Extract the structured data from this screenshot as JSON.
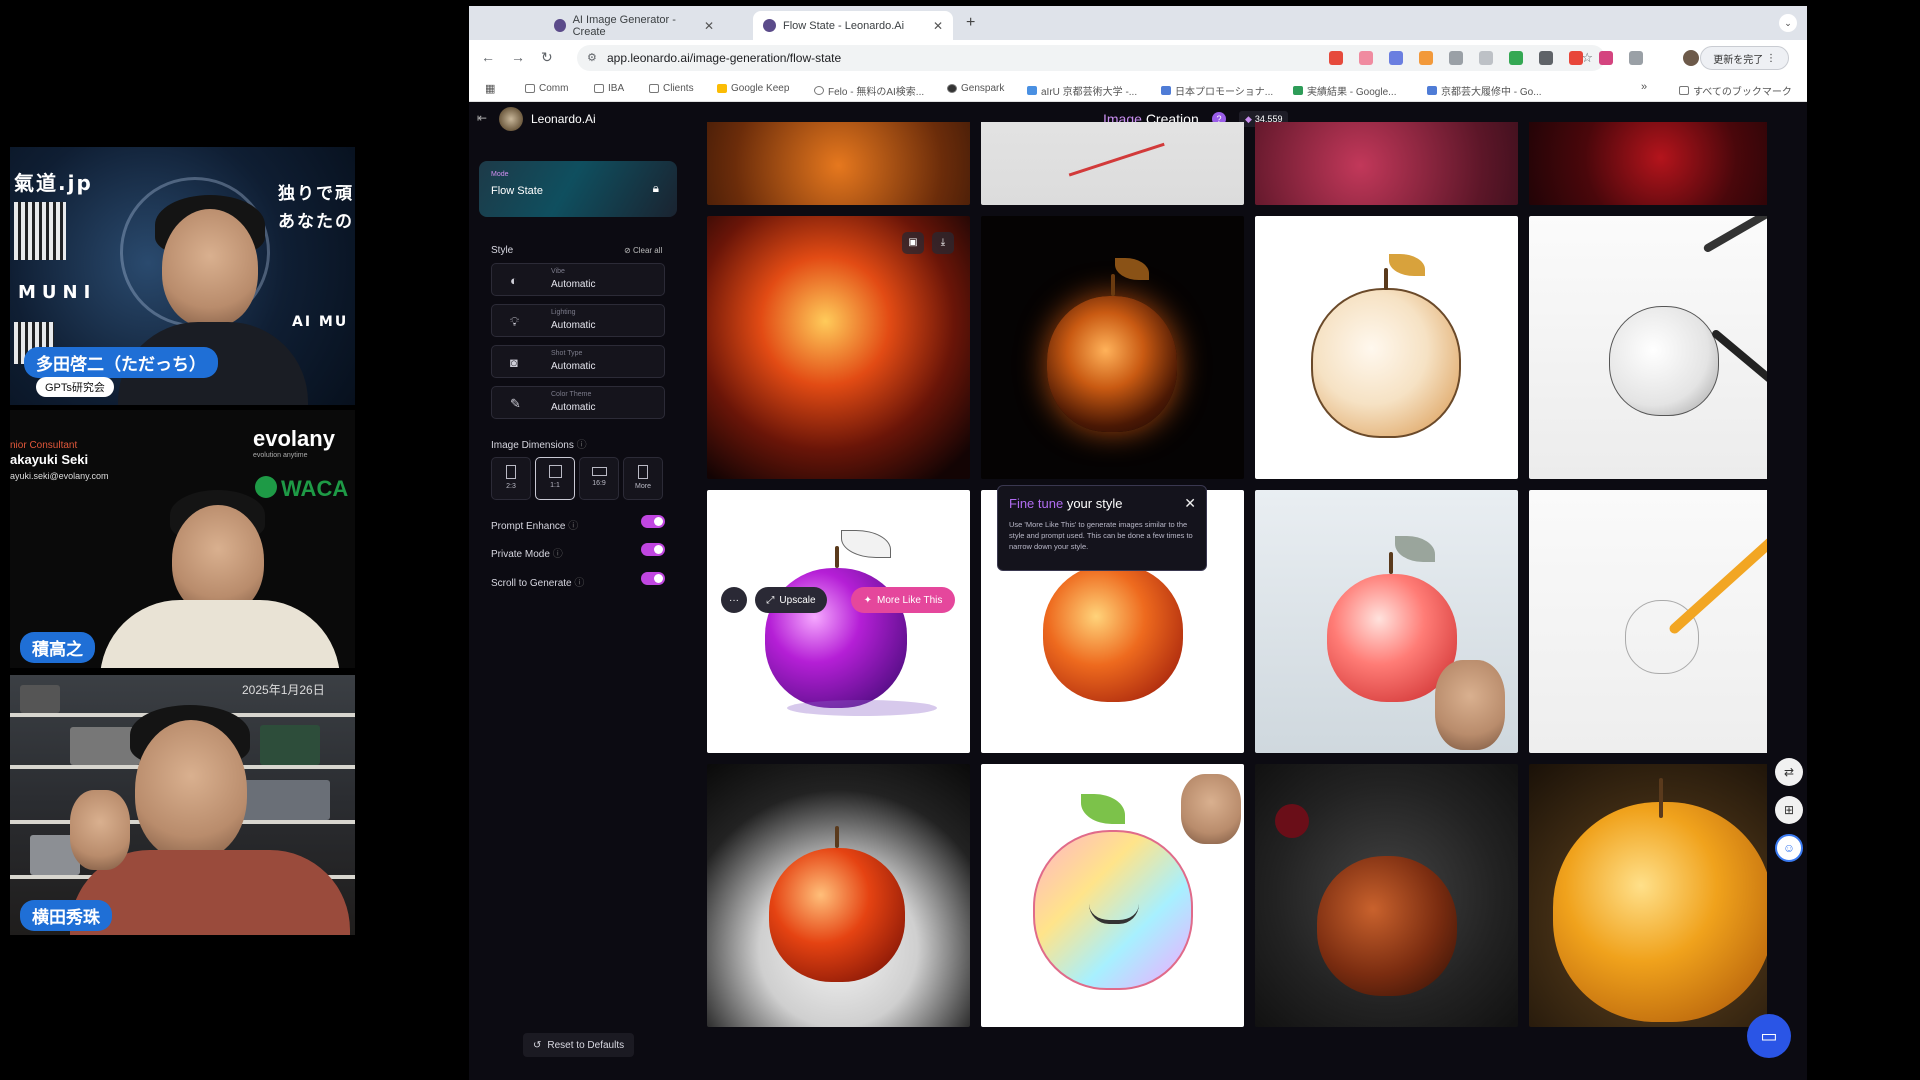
{
  "participants": [
    {
      "name": "多田啓二（ただっち）",
      "tag": "GPTs研究会",
      "overlay": [
        "氣道.jp",
        "MUNI",
        "独りで頑",
        "あなたの",
        "AI MU"
      ]
    },
    {
      "name": "積高之",
      "brand": "evolany",
      "brand_sub": "evolution anytime",
      "brand2": "WACA",
      "role": "nior Consultant",
      "person": "akayuki Seki",
      "email": "ayuki.seki@evolany.com"
    },
    {
      "name": "横田秀珠",
      "stamp": "2025年1月26日"
    }
  ],
  "browser": {
    "tabs": [
      {
        "label": "AI Image Generator - Create",
        "active": false
      },
      {
        "label": "Flow State - Leonardo.Ai",
        "active": true
      }
    ],
    "new_tab": "+",
    "url": "app.leonardo.ai/image-generation/flow-state",
    "update_button": "更新を完了",
    "bookmarks": [
      "Comm",
      "IBA",
      "Clients",
      "Google Keep",
      "Felo - 無料のAI検索...",
      "Genspark",
      "aIrU 京都芸術大学 -...",
      "日本プロモーショナ...",
      "実績結果 - Google...",
      "京都芸大履修中 - Go..."
    ],
    "bookmarks_more": "すべてのブックマーク"
  },
  "app": {
    "brand": "Leonardo.Ai",
    "title_accent": "Image",
    "title_rest": "Creation",
    "help": "?",
    "credits": "34,559",
    "mode_label": "Mode",
    "mode_value": "Flow State",
    "style_label": "Style",
    "clear_all": "Clear all",
    "style_rows": [
      {
        "key": "Vibe",
        "value": "Automatic"
      },
      {
        "key": "Lighting",
        "value": "Automatic"
      },
      {
        "key": "Shot Type",
        "value": "Automatic"
      },
      {
        "key": "Color Theme",
        "value": "Automatic"
      }
    ],
    "dimensions_label": "Image Dimensions",
    "dimensions": [
      "2:3",
      "1:1",
      "16:9",
      "More"
    ],
    "toggles": [
      {
        "label": "Prompt Enhance",
        "on": true
      },
      {
        "label": "Private Mode",
        "on": true
      },
      {
        "label": "Scroll to Generate",
        "on": true
      }
    ],
    "reset": "Reset to Defaults",
    "tooltip": {
      "title_accent": "Fine tune",
      "title_rest": "your style",
      "body": "Use 'More Like This' to generate images similar to the style and prompt used. This can be done a few times to narrow down your style."
    },
    "actions": {
      "more": "···",
      "upscale": "Upscale",
      "more_like_this": "More Like This"
    },
    "colors": {
      "accent": "#c046e0",
      "pink_button": "#e5479c",
      "chat": "#2a55e6"
    }
  }
}
